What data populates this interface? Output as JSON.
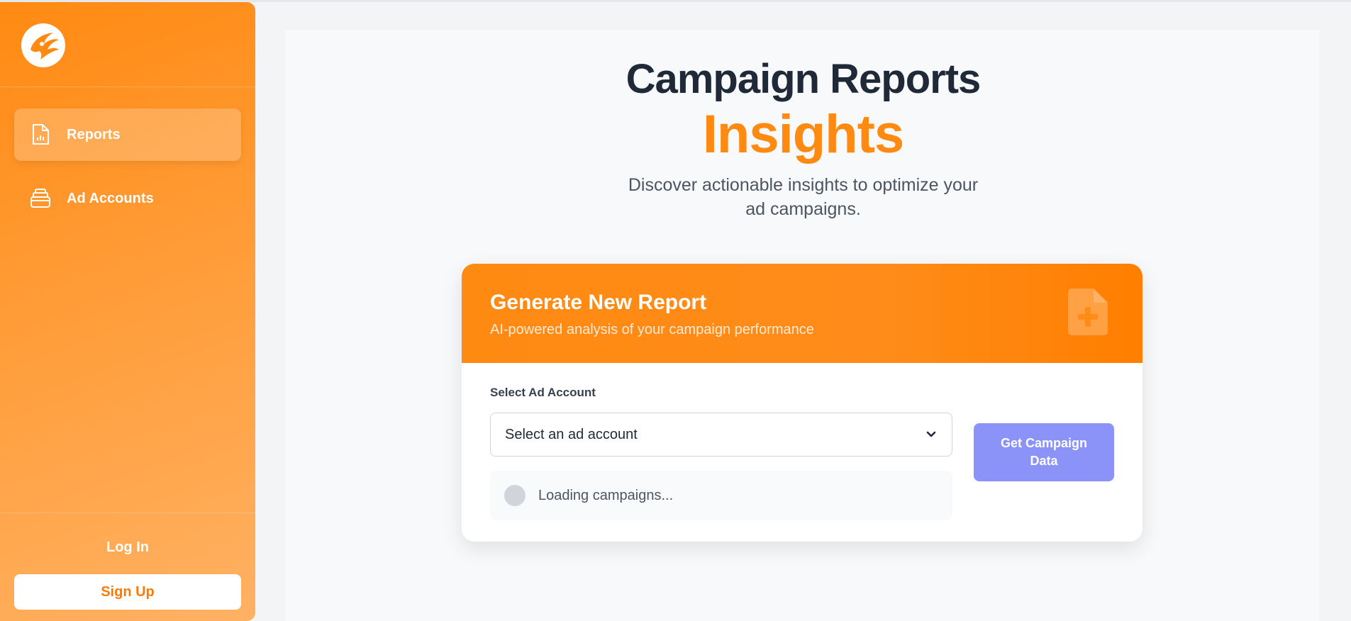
{
  "sidebar": {
    "logo_icon": "phoenix-logo-icon",
    "items": [
      {
        "label": "Reports",
        "icon": "report-document-icon",
        "active": true
      },
      {
        "label": "Ad Accounts",
        "icon": "stacked-accounts-icon",
        "active": false
      }
    ],
    "login_label": "Log In",
    "signup_label": "Sign Up"
  },
  "header": {
    "title": "Campaign Reports",
    "subtitle": "Insights",
    "description_line1": "Discover actionable insights to optimize your",
    "description_line2": "ad campaigns."
  },
  "card": {
    "title": "Generate New Report",
    "subtitle": "AI-powered analysis of your campaign performance",
    "header_icon": "document-plus-icon",
    "field_label": "Select Ad Account",
    "select_value": "Select an ad account",
    "loading_text": "Loading campaigns...",
    "button_label": "Get Campaign Data"
  },
  "colors": {
    "accent": "#ff8a12",
    "button": "#8b93f8",
    "title": "#1f2937"
  }
}
